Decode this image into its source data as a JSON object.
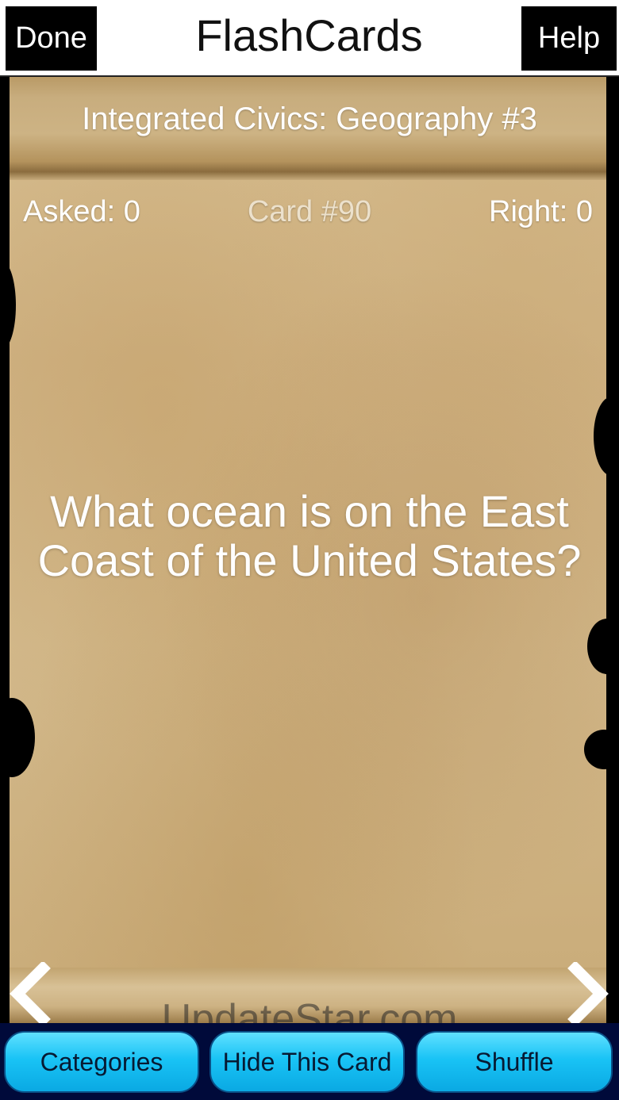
{
  "topbar": {
    "done_label": "Done",
    "title": "FlashCards",
    "help_label": "Help"
  },
  "card": {
    "category": "Integrated Civics: Geography #3",
    "asked": "Asked: 0",
    "card_number": "Card #90",
    "right": "Right: 0",
    "question": "What ocean is on the East Coast of the United States?"
  },
  "navigation": {
    "prev_icon": "chevron-left-icon",
    "next_icon": "chevron-right-icon"
  },
  "watermark": "UpdateStar.com",
  "bottombar": {
    "categories_label": "Categories",
    "hide_label": "Hide This Card",
    "shuffle_label": "Shuffle"
  },
  "colors": {
    "button_accent": "#19c3f5",
    "bottom_bar": "#000a3a",
    "parchment": "#d2b88a"
  }
}
